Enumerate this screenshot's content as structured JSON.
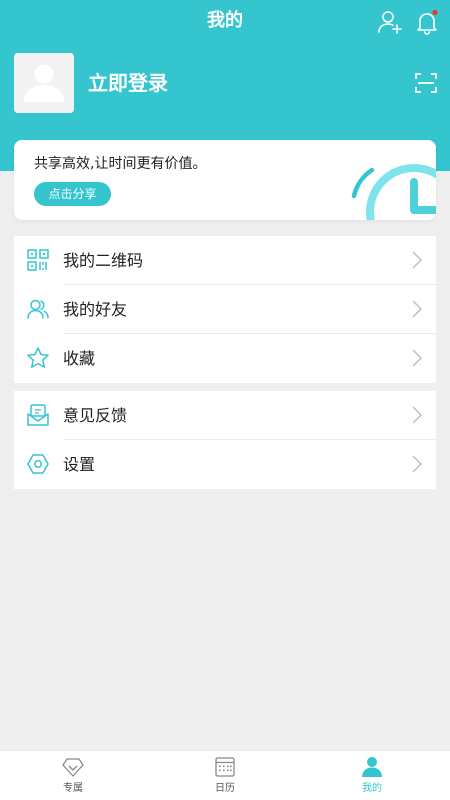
{
  "header": {
    "title": "我的"
  },
  "profile": {
    "login_label": "立即登录"
  },
  "share": {
    "slogan": "共享高效,让时间更有价值。",
    "button_label": "点击分享"
  },
  "menu": {
    "group1": [
      {
        "label": "我的二维码",
        "icon": "qr-code-icon"
      },
      {
        "label": "我的好友",
        "icon": "friends-icon"
      },
      {
        "label": "收藏",
        "icon": "star-icon"
      }
    ],
    "group2": [
      {
        "label": "意见反馈",
        "icon": "feedback-icon"
      },
      {
        "label": "设置",
        "icon": "settings-icon"
      }
    ]
  },
  "tabbar": {
    "items": [
      {
        "label": "专属",
        "icon": "diamond-icon",
        "active": false
      },
      {
        "label": "日历",
        "icon": "calendar-icon",
        "active": false
      },
      {
        "label": "我的",
        "icon": "person-icon",
        "active": true
      }
    ]
  },
  "colors": {
    "accent": "#34c5cf",
    "notification_dot": "#e53935",
    "background": "#efefef"
  }
}
